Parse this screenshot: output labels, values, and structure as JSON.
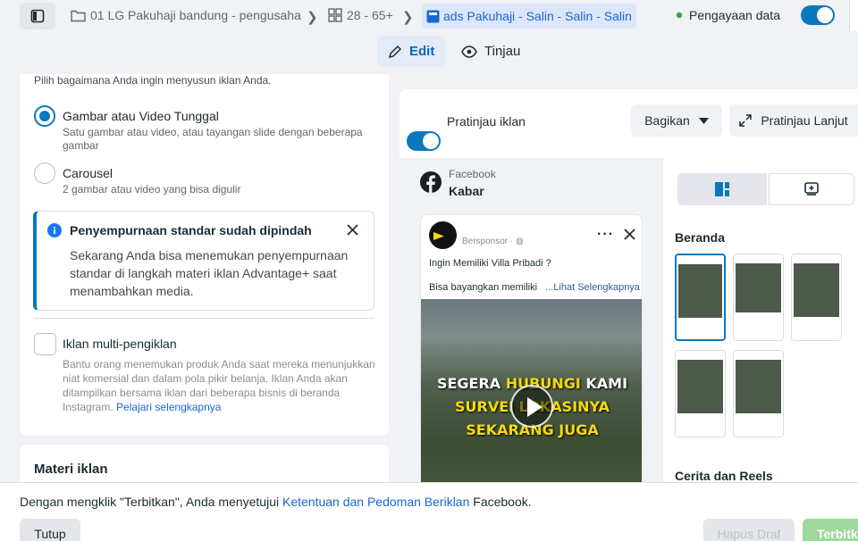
{
  "topbar": {
    "crumbs": [
      {
        "label": "01 LG Pakuhaji bandung - pengusaha",
        "icon": "folder-icon"
      },
      {
        "label": "28 - 65+",
        "icon": "grid-icon"
      },
      {
        "label": "ads Pakuhaji - Salin - Salin - Salin",
        "icon": "ad-icon"
      }
    ],
    "status_label": "Pengayaan data"
  },
  "tabs": {
    "edit": "Edit",
    "review": "Tinjau"
  },
  "left": {
    "intro": "Pilih bagaimana Anda ingin menyusun iklan Anda.",
    "options": [
      {
        "title": "Gambar atau Video Tunggal",
        "desc": "Satu gambar atau video, atau tayangan slide dengan beberapa gambar",
        "selected": true
      },
      {
        "title": "Carousel",
        "desc": "2 gambar atau video yang bisa digulir",
        "selected": false
      }
    ],
    "notice": {
      "title": "Penyempurnaan standar sudah dipindah",
      "body": "Sekarang Anda bisa menemukan penyempurnaan standar di langkah materi iklan Advantage+ saat menambahkan media."
    },
    "multi": {
      "title": "Iklan multi-pengiklan",
      "desc": "Bantu orang menemukan produk Anda saat mereka menunjukkan niat komersial dan dalam pola pikir belanja. Iklan Anda akan ditampilkan bersama iklan dari beberapa bisnis di beranda Instagram.",
      "link": "Pelajari selengkapnya"
    },
    "materi_title": "Materi iklan"
  },
  "preview": {
    "toggle_label": "Pratinjau iklan",
    "share_label": "Bagikan",
    "advanced_label": "Pratinjau Lanjut",
    "platform": "Facebook",
    "placement": "Kabar",
    "post": {
      "sponsored": "Bersponsor · ",
      "headline": "Ingin Memiliki Villa Pribadi ?",
      "body": "Bisa bayangkan memiliki",
      "more": "...Lihat Selengkapnya",
      "overlay": {
        "line1a": "SEGERA ",
        "line1b": "HUBUNGI",
        "line1c": " KAMI",
        "line2": "SURVEI LOKASINYA",
        "line3": "SEKARANG JUGA"
      }
    },
    "sections": {
      "beranda": "Beranda",
      "reels": "Cerita dan Reels"
    }
  },
  "footer": {
    "terms_prefix": "Dengan mengklik \"Terbitkan\", Anda menyetujui ",
    "terms_link": "Ketentuan dan Pedoman Beriklan",
    "terms_suffix": " Facebook.",
    "close": "Tutup",
    "delete_draft": "Hapus Draf",
    "publish": "Terbitkan"
  },
  "colors": {
    "accent": "#0a78be",
    "highlight_yellow": "#f5d90a",
    "success": "#31a24c"
  }
}
